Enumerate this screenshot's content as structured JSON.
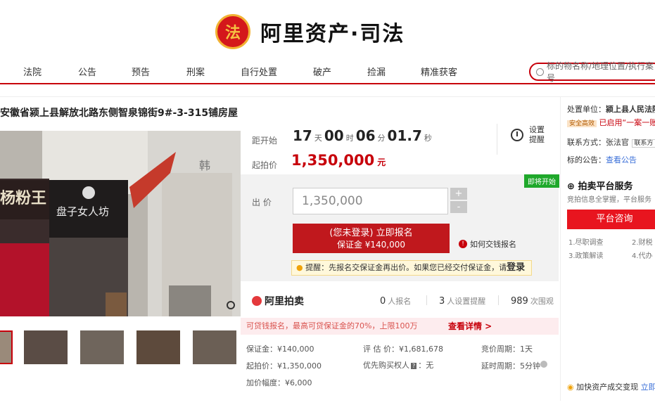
{
  "header": {
    "logo_text": "阿里资产·司法",
    "emblem_char": "法",
    "nav": [
      "法院",
      "公告",
      "预告",
      "刑案",
      "自行处置",
      "破产",
      "捡漏",
      "精准获客"
    ],
    "search_placeholder": "标的物名称/地理位置/执行案号"
  },
  "item": {
    "title": "安徽省颍上县解放北路东侧智泉锦街9#-3-315铺房屋",
    "photo_sign_left": "杨粉王",
    "photo_sign_mid": "盘子女人坊",
    "photo_sign_right": "韩"
  },
  "auction": {
    "countdown_label": "距开始",
    "countdown": {
      "days": "17",
      "days_unit": "天",
      "hours": "00",
      "hours_unit": "时",
      "minutes": "06",
      "minutes_unit": "分",
      "seconds": "01.7",
      "seconds_unit": "秒"
    },
    "start_label": "起拍价",
    "start_price": "1,350,000",
    "price_unit": "元",
    "remind_label": "设置提醒",
    "status_tag": "即将开始",
    "bid_label": "出 价",
    "bid_value": "1,350,000",
    "plus": "+",
    "minus": "-",
    "register_line1": "(您未登录) 立即报名",
    "register_line2": "保证金 ¥140,000",
    "howto": "如何交钱报名",
    "tip_text": "提醒：先报名交保证金再出价。如果您已经交付保证金，请",
    "tip_login": "登录"
  },
  "stats": {
    "brand": "阿里拍卖",
    "signups": "0",
    "signups_label": "人报名",
    "reminders": "3",
    "reminders_label": "人设置提醒",
    "views": "989",
    "views_label": "次围观"
  },
  "loan_bar": {
    "text": "可贷钱报名，最高可贷保证金的70%，上限100万",
    "detail": "查看详情 >"
  },
  "info": {
    "deposit": "保证金：¥140,000",
    "appraisal": "评 估 价：¥1,681,678",
    "cycle": "竞价周期：1天",
    "start": "起拍价：¥1,350,000",
    "priority": "优先购买权人",
    "priority_value": "：无",
    "delay": "延时周期：5分钟",
    "increment": "加价幅度：¥6,000"
  },
  "sidebar": {
    "court_label": "处置单位：",
    "court": "颍上县人民法院",
    "safe_tag": "安全高效",
    "safe_text": "已启用“一案一账",
    "contact_label": "联系方式：张法官",
    "contact_btn": "联系方",
    "notice_label": "标的公告：",
    "notice_link": "查看公告",
    "service_title": "拍卖平台服务",
    "service_sub": "竞拍信息全掌握，平台服务",
    "consult": "平台咨询",
    "s1": "1.尽职调查",
    "s2": "2.财税",
    "s3": "3.政策解读",
    "s4": "4.代办",
    "bottom_text": "加快资产成交变现",
    "bottom_link": "立即"
  },
  "colors": {
    "brand_red": "#c7000b",
    "button_red": "#c0181d",
    "tag_green": "#1fa82b"
  }
}
